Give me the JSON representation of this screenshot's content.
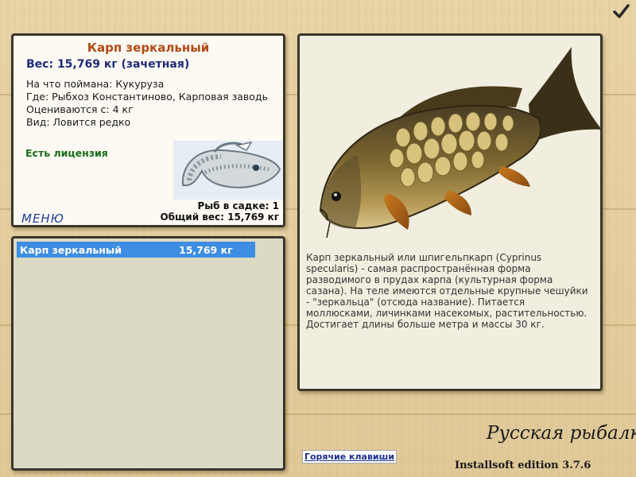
{
  "fish": {
    "name": "Карп зеркальный",
    "weight_line": "Вес: 15,769 кг (зачетная)",
    "caught_on": "На что поймана: Кукуруза",
    "location": "Где: Рыбхоз Константиново, Карповая заводь",
    "rated_from": "Оцениваются с: 4 кг",
    "kind": "Вид: Ловится редко",
    "license": "Есть лицензия",
    "description": "Карп зеркальный или шпигельпкарп (Cyprinus specularis) - самая распространённая форма разводимого в прудах карпа (культурная форма сазана). На теле имеются отдельные крупные чешуйки - \"зеркальца\" (отсюда название). Питается моллюсками, личинками насекомых, растительностью. Достигает длины больше метра и массы 30 кг."
  },
  "menu_label": "МЕНЮ",
  "keepnet": {
    "count_line": "Рыб в садке: 1",
    "total_line": "Общий вес: 15,769 кг",
    "items": [
      {
        "name": "Карп зеркальный",
        "weight": "15,769 кг"
      }
    ]
  },
  "footer": {
    "hotkeys_label": "Горячие клавиши",
    "brand": "Русская рыбалка",
    "edition": "Installsoft edition 3.7.6"
  },
  "icons": {
    "confirm": "checkmark-icon",
    "logo": "fish-logo-icon"
  },
  "colors": {
    "title": "#b34a14",
    "weight": "#1e2b7a",
    "license": "#1a6d1a",
    "selection": "#3d8de2"
  }
}
